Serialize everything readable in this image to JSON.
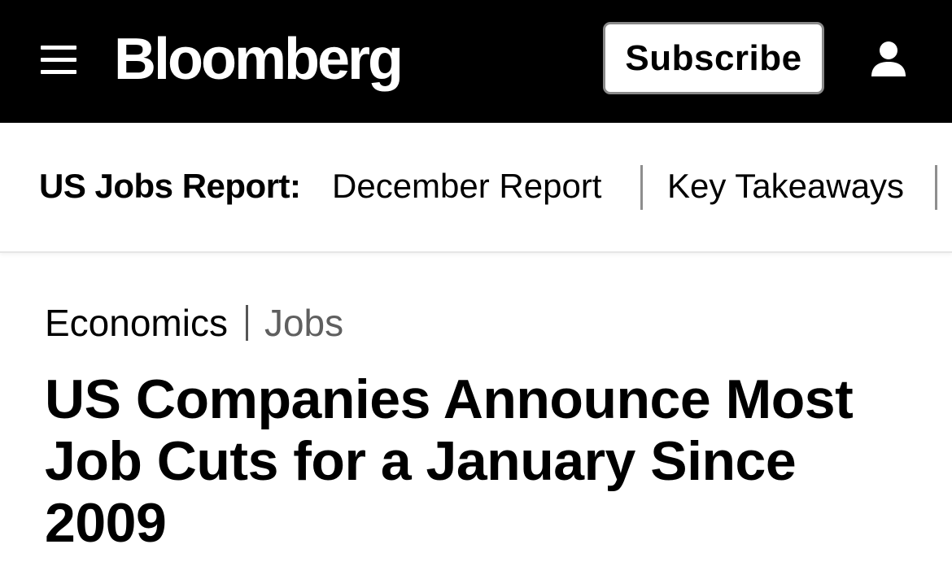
{
  "header": {
    "menu_icon": "hamburger-menu-icon",
    "logo_text": "Bloomberg",
    "subscribe_label": "Subscribe",
    "user_icon": "user-account-icon",
    "background_color": "#000000",
    "logo_color": "#ffffff"
  },
  "subnav": {
    "label": "US Jobs Report:",
    "links": [
      {
        "label": "December Report"
      },
      {
        "label": "Key Takeaways"
      }
    ]
  },
  "article": {
    "breadcrumb": {
      "primary": "Economics",
      "secondary": "Jobs"
    },
    "headline": "US Companies Announce Most Job Cuts for a January Since 2009"
  }
}
